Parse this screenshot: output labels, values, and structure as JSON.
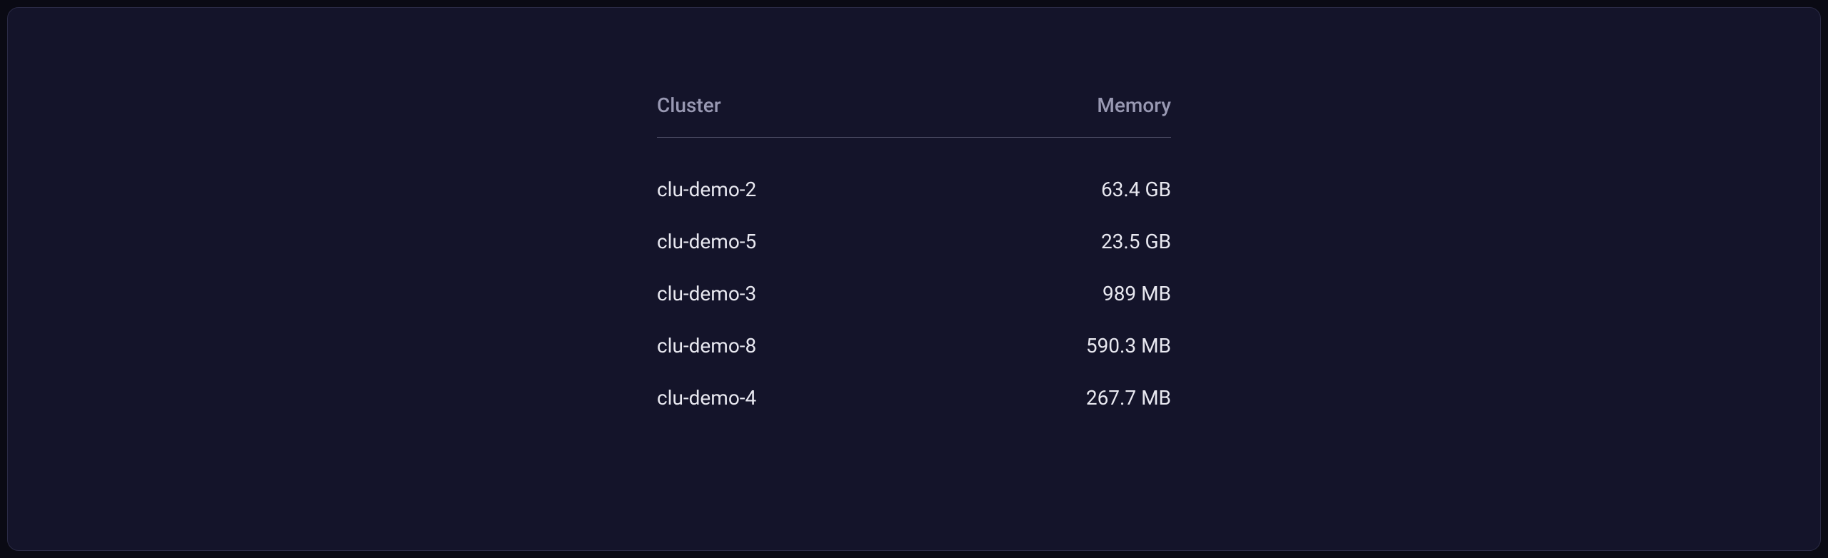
{
  "table": {
    "headers": {
      "cluster": "Cluster",
      "memory": "Memory"
    },
    "rows": [
      {
        "cluster": "clu-demo-2",
        "memory": "63.4 GB"
      },
      {
        "cluster": "clu-demo-5",
        "memory": "23.5 GB"
      },
      {
        "cluster": "clu-demo-3",
        "memory": "989 MB"
      },
      {
        "cluster": "clu-demo-8",
        "memory": "590.3 MB"
      },
      {
        "cluster": "clu-demo-4",
        "memory": "267.7 MB"
      }
    ]
  }
}
